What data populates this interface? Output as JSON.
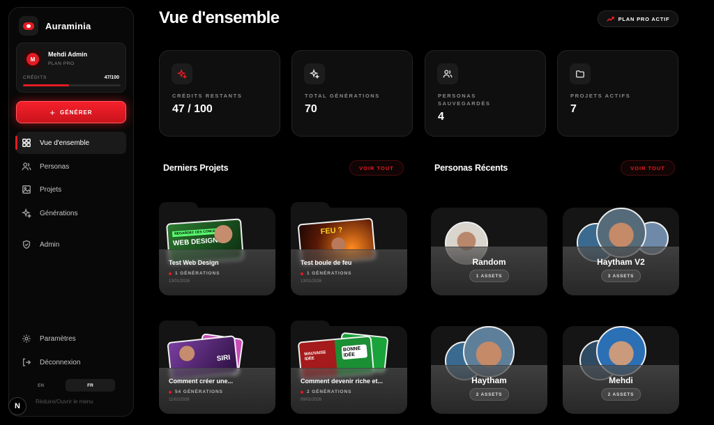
{
  "app": {
    "name": "Auraminia"
  },
  "user": {
    "initial": "M",
    "name": "Mehdi Admin",
    "plan": "PLAN PRO",
    "credits_label": "CRÉDITS",
    "credits_value": "47/100",
    "credits_fraction": 0.47
  },
  "sidebar": {
    "generate_label": "GÉNÉRER",
    "nav": [
      {
        "label": "Vue d'ensemble",
        "icon": "grid-icon",
        "active": true
      },
      {
        "label": "Personas",
        "icon": "users-icon"
      },
      {
        "label": "Projets",
        "icon": "image-icon"
      },
      {
        "label": "Générations",
        "icon": "sparkles-icon"
      },
      {
        "label": "Admin",
        "icon": "shield-icon"
      }
    ],
    "settings_label": "Paramètres",
    "logout_label": "Déconnexion",
    "lang_en": "EN",
    "lang_fr": "FR",
    "collapse_hint": "Réduire/Ouvrir le menu",
    "badge": "N"
  },
  "header": {
    "title": "Vue d'ensemble",
    "plan_badge": "PLAN PRO ACTIF"
  },
  "stats": [
    {
      "label": "CRÉDITS RESTANTS",
      "value": "47 / 100",
      "icon": "sparkles-red-icon"
    },
    {
      "label": "TOTAL GÉNÉRATIONS",
      "value": "70",
      "icon": "sparkles-icon"
    },
    {
      "label": "PERSONAS SAUVEGARDÉS",
      "value": "4",
      "icon": "users-icon"
    },
    {
      "label": "PROJETS ACTIFS",
      "value": "7",
      "icon": "folder-icon"
    }
  ],
  "projects_section": {
    "title": "Derniers Projets",
    "see_all": "VOIR TOUT",
    "items": [
      {
        "name": "Test Web Design",
        "generations": "1 GÉNÉRATIONS",
        "date": "13/01/2026",
        "thumb_text": "WEB DESIGNE",
        "thumb_tag": "REGARDEZ CES CONCEPTS"
      },
      {
        "name": "Test boule de feu",
        "generations": "1 GÉNÉRATIONS",
        "date": "13/01/2026",
        "thumb_text": "FEU ?"
      },
      {
        "name": "Comment créer une...",
        "generations": "54 GÉNÉRATIONS",
        "date": "11/01/2026",
        "thumb_text": "SIRI"
      },
      {
        "name": "Comment devenir riche et...",
        "generations": "2 GÉNÉRATIONS",
        "date": "09/01/2026",
        "thumb_text": "BONNE IDÉE",
        "thumb_text2": "MAUVAISE IDÉE"
      }
    ]
  },
  "personas_section": {
    "title": "Personas Récents",
    "see_all": "VOIR TOUT",
    "items": [
      {
        "name": "Random",
        "assets": "1 ASSETS"
      },
      {
        "name": "Haytham V2",
        "assets": "3 ASSETS"
      },
      {
        "name": "Haytham",
        "assets": "2 ASSETS"
      },
      {
        "name": "Mehdi",
        "assets": "2 ASSETS"
      }
    ]
  },
  "colors": {
    "accent": "#e31b23",
    "background": "#000000",
    "card": "#0f0f0f"
  }
}
